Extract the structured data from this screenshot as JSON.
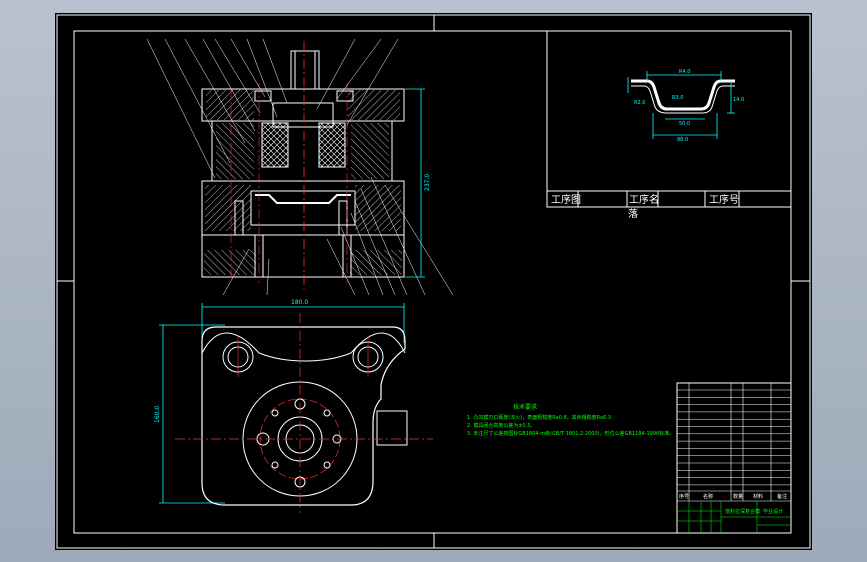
{
  "colors": {
    "background": "#000000",
    "frame": "#ffffff",
    "dimension": "#00ffff",
    "notes": "#00ff00",
    "centerline": "#ff3030",
    "part": "#ffffff",
    "leader": "#ffffff"
  },
  "drawing": {
    "process_table": {
      "header_drawing": "工序图",
      "header_name": "工序名",
      "header_number": "工序号",
      "value_name": "落"
    },
    "dimensions": {
      "die_width": "180.0",
      "die_height": "160.0",
      "closed_height": "237.0",
      "part_top": "R4.0",
      "part_flange": "R2.0",
      "part_inner": "R3.0",
      "part_depth": "14.0",
      "part_bottom": "R2.0",
      "part_width": "50.0",
      "part_outer": "88.0"
    },
    "notes": {
      "title": "技术要求",
      "line1": "1. 凸凹模刃口硬度(淬火)，表面粗糙度Ra0.8，其余粗糙度Ra6.3",
      "line2": "2. 模具闭合高度公差为±0.5。",
      "line3": "3. 未注尺寸公差按国标GB1804-m级(GB/T 1801.2-2000)，形位公差GB1184-1996标准。"
    },
    "title_block": {
      "col_seq": "序号",
      "col_name": "名称",
      "col_qty": "数量",
      "col_material": "材料",
      "col_remark": "备注",
      "drawing_name": "落料拉深复合模",
      "company": "毕业设计"
    }
  }
}
